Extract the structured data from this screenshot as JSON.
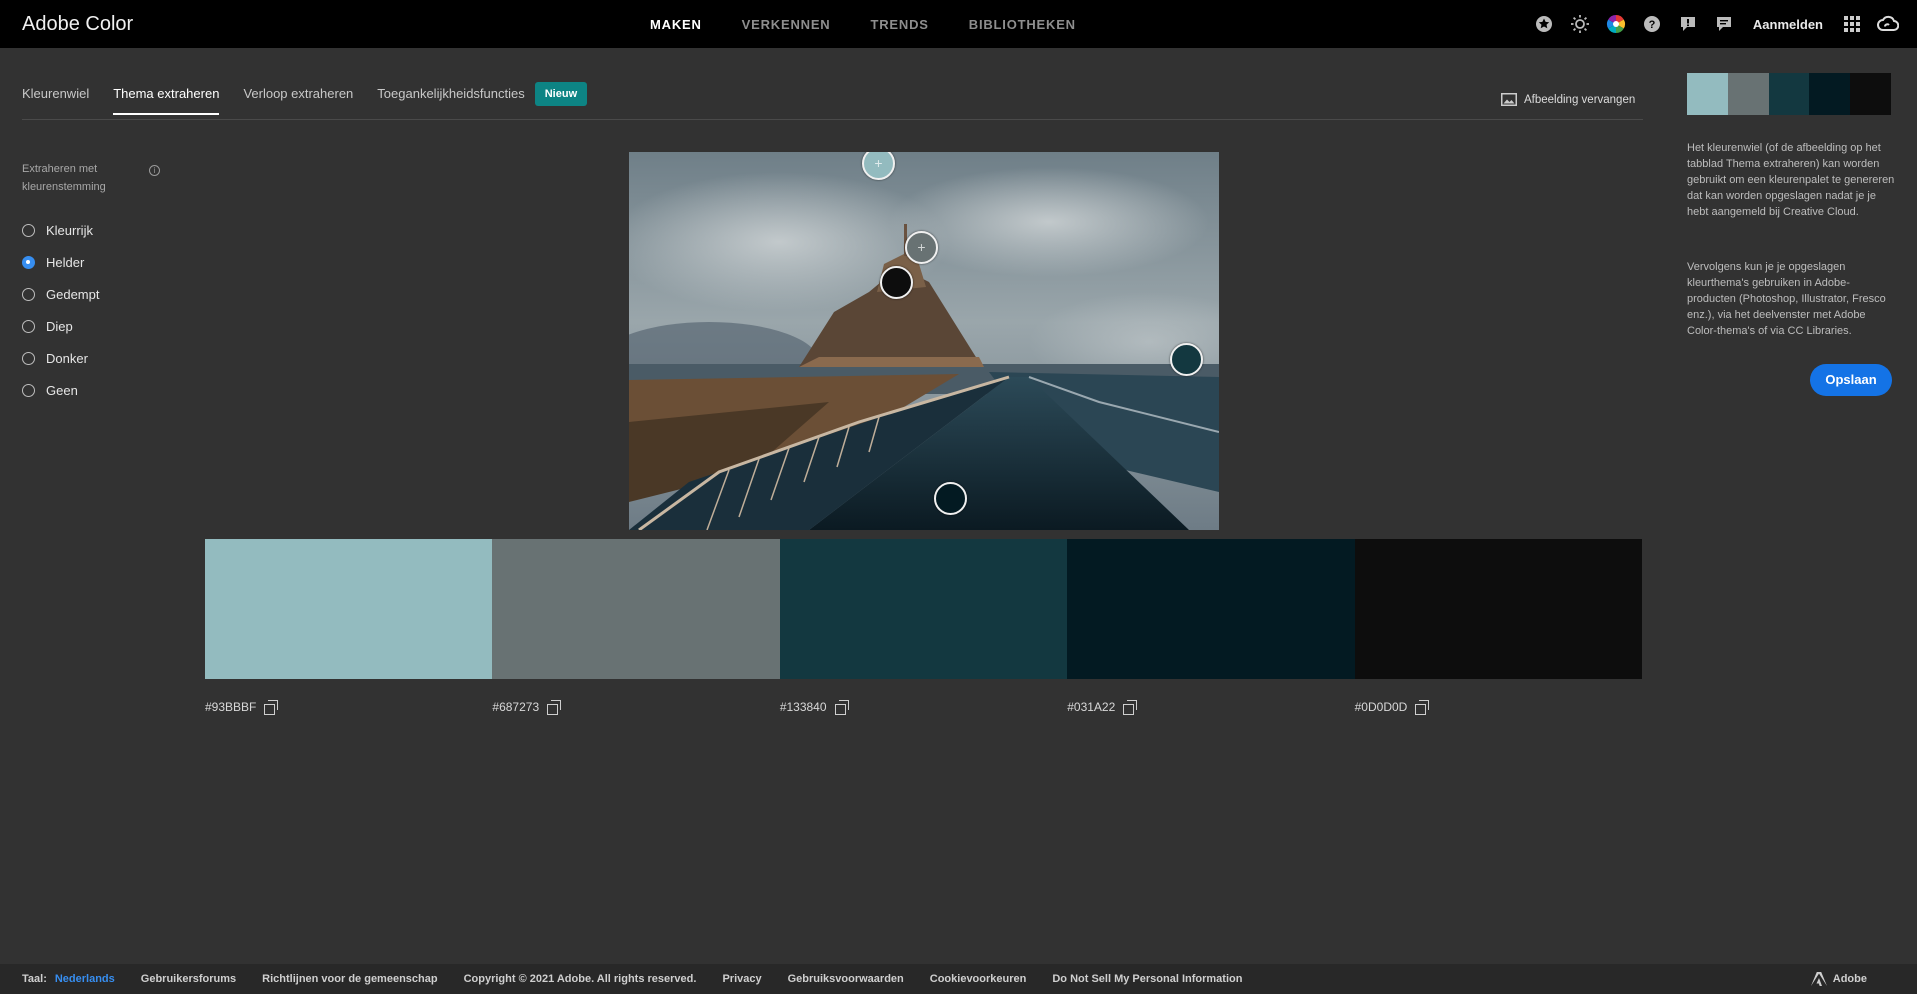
{
  "app": {
    "title": "Adobe Color"
  },
  "nav": {
    "items": [
      {
        "label": "MAKEN",
        "active": true
      },
      {
        "label": "VERKENNEN",
        "active": false
      },
      {
        "label": "TRENDS",
        "active": false
      },
      {
        "label": "BIBLIOTHEKEN",
        "active": false
      }
    ],
    "signin": "Aanmelden",
    "icons": [
      "star-icon",
      "sun-icon",
      "color-wheel-icon",
      "help-icon",
      "alert-icon",
      "chat-icon",
      "apps-grid-icon",
      "creative-cloud-icon"
    ]
  },
  "tabs": {
    "items": [
      {
        "label": "Kleurenwiel",
        "active": false
      },
      {
        "label": "Thema extraheren",
        "active": true
      },
      {
        "label": "Verloop extraheren",
        "active": false
      },
      {
        "label": "Toegankelijkheidsfuncties",
        "active": false
      }
    ],
    "badge": "Nieuw",
    "replace_image": "Afbeelding vervangen"
  },
  "mood": {
    "label": "Extraheren met kleurenstemming",
    "options": [
      {
        "label": "Kleurrijk",
        "checked": false
      },
      {
        "label": "Helder",
        "checked": true
      },
      {
        "label": "Gedempt",
        "checked": false
      },
      {
        "label": "Diep",
        "checked": false
      },
      {
        "label": "Donker",
        "checked": false
      },
      {
        "label": "Geen",
        "checked": false
      }
    ]
  },
  "palette": [
    {
      "hex": "#93BBBF",
      "color": "#93bbbf"
    },
    {
      "hex": "#687273",
      "color": "#687273"
    },
    {
      "hex": "#133840",
      "color": "#133840"
    },
    {
      "hex": "#031A22",
      "color": "#031a22"
    },
    {
      "hex": "#0D0D0D",
      "color": "#0d0d0d"
    }
  ],
  "sidebar": {
    "description1": "Het kleurenwiel (of de afbeelding op het tabblad Thema extraheren) kan worden gebruikt om een kleurenpalet te genereren dat kan worden opgeslagen nadat je je hebt aangemeld bij Creative Cloud.",
    "description2": "Vervolgens kun je je opgeslagen kleurthema's gebruiken in Adobe-producten (Photoshop, Illustrator, Fresco enz.), via het deelvenster met Adobe Color-thema's of via CC Libraries.",
    "save": "Opslaan"
  },
  "footer": {
    "lang_label": "Taal:",
    "lang": "Nederlands",
    "links": [
      "Gebruikersforums",
      "Richtlijnen voor de gemeenschap",
      "Copyright © 2021 Adobe. All rights reserved.",
      "Privacy",
      "Gebruiksvoorwaarden",
      "Cookievoorkeuren",
      "Do Not Sell My Personal Information"
    ],
    "brand": "Adobe"
  }
}
